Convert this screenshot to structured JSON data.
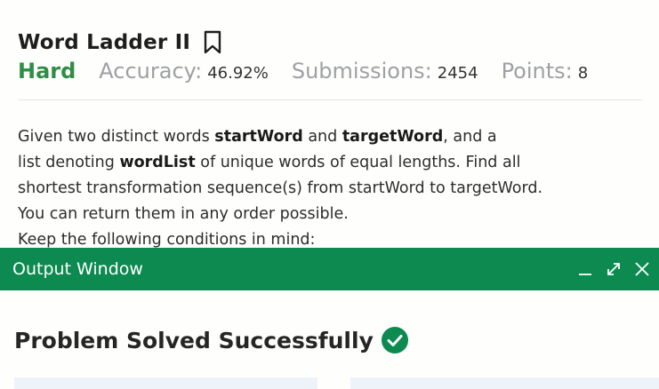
{
  "problem": {
    "title": "Word Ladder II",
    "difficulty": "Hard",
    "accuracy_label": "Accuracy:",
    "accuracy_value": "46.92%",
    "submissions_label": "Submissions:",
    "submissions_value": "2454",
    "points_label": "Points:",
    "points_value": "8"
  },
  "description": {
    "l1_a": "Given two distinct words ",
    "l1_b": "startWord",
    "l1_c": " and ",
    "l1_d": "targetWord",
    "l1_e": ", and a",
    "l2_a": "list denoting ",
    "l2_b": "wordList",
    "l2_c": " of unique words of equal lengths. Find all",
    "l3": "shortest transformation sequence(s) from startWord to targetWord.",
    "l4": "You can return them in any order possible.",
    "l5": "Keep the following conditions in mind:"
  },
  "output_window": {
    "title": "Output Window",
    "result": "Problem Solved Successfully"
  },
  "colors": {
    "accent_green": "#0c8a50",
    "difficulty_green": "#2f8d46"
  },
  "icons": {
    "bookmark": "bookmark-icon",
    "minimize": "minimize-icon",
    "expand": "expand-icon",
    "close": "close-icon",
    "check": "check-circle-icon"
  }
}
